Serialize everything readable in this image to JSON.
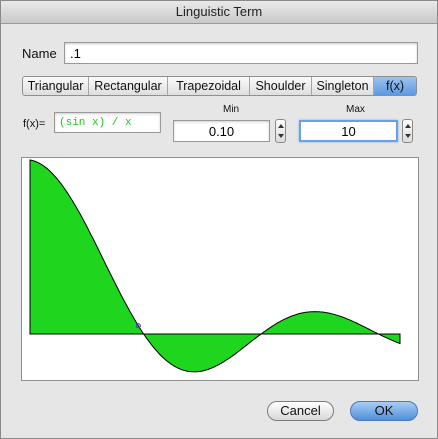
{
  "window": {
    "title": "Linguistic Term"
  },
  "name": {
    "label": "Name",
    "value": ".1"
  },
  "tabs": [
    {
      "label": "Triangular",
      "selected": false
    },
    {
      "label": "Rectangular",
      "selected": false
    },
    {
      "label": "Trapezoidal",
      "selected": false
    },
    {
      "label": "Shoulder",
      "selected": false
    },
    {
      "label": "Singleton",
      "selected": false
    },
    {
      "label": "f(x)",
      "selected": true
    }
  ],
  "formula": {
    "label": "f(x)=",
    "value": "(sin x) / x"
  },
  "range": {
    "min_label": "Min",
    "min_value": "0.10",
    "max_label": "Max",
    "max_value": "10"
  },
  "plot": {
    "function": "sin(x)/x",
    "x_min": 0.1,
    "x_max": 10,
    "fill_color": "#1fd61f",
    "marker_color": "#3a3acc",
    "marker_x": 3.0
  },
  "buttons": {
    "cancel": "Cancel",
    "ok": "OK"
  },
  "colors": {
    "accent": "#5d99e0",
    "formula_text": "#1fc51f"
  }
}
